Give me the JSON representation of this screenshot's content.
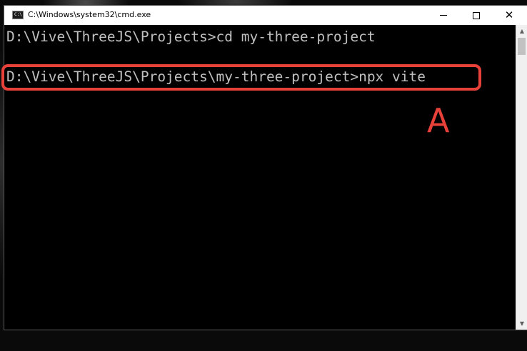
{
  "window": {
    "title": "C:\\Windows\\system32\\cmd.exe",
    "app_icon_text": "C:\\"
  },
  "controls": {
    "minimize_icon": "minimize-icon",
    "maximize_icon": "maximize-icon",
    "close_icon": "close-icon",
    "close_glyph": "✕"
  },
  "console": {
    "lines": [
      "D:\\Vive\\ThreeJS\\Projects>cd my-three-project",
      "D:\\Vive\\ThreeJS\\Projects\\my-three-project>npx vite"
    ]
  },
  "annotation": {
    "label": "A",
    "color": "#e8413a"
  },
  "scrollbar": {
    "up_arrow": "▲",
    "down_arrow": "▼"
  }
}
